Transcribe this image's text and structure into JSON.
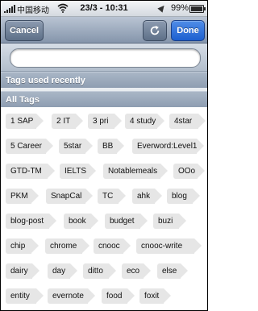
{
  "status": {
    "carrier": "中国移动",
    "time": "23/3 - 10:31",
    "battery_pct": "99%",
    "battery_level": 0.99
  },
  "nav": {
    "cancel": "Cancel",
    "done": "Done",
    "refresh_icon": "refresh-icon"
  },
  "search": {
    "placeholder": "",
    "value": ""
  },
  "sections": {
    "recent": "Tags used recently",
    "all": "All Tags"
  },
  "tags": [
    "1 SAP",
    "2 IT",
    "3 pri",
    "4 study",
    "4star",
    "5 Career",
    "5star",
    "BB",
    "Everword:Level1",
    "GTD-TM",
    "IELTS",
    "Notablemeals",
    "OOo",
    "PKM",
    "SnapCal",
    "TC",
    "ahk",
    "blog",
    "blog-post",
    "book",
    "budget",
    "buzi",
    "chip",
    "chrome",
    "cnooc",
    "cnooc-write",
    "dairy",
    "day",
    "ditto",
    "eco",
    "else",
    "entity",
    "evernote",
    "food",
    "foxit"
  ]
}
